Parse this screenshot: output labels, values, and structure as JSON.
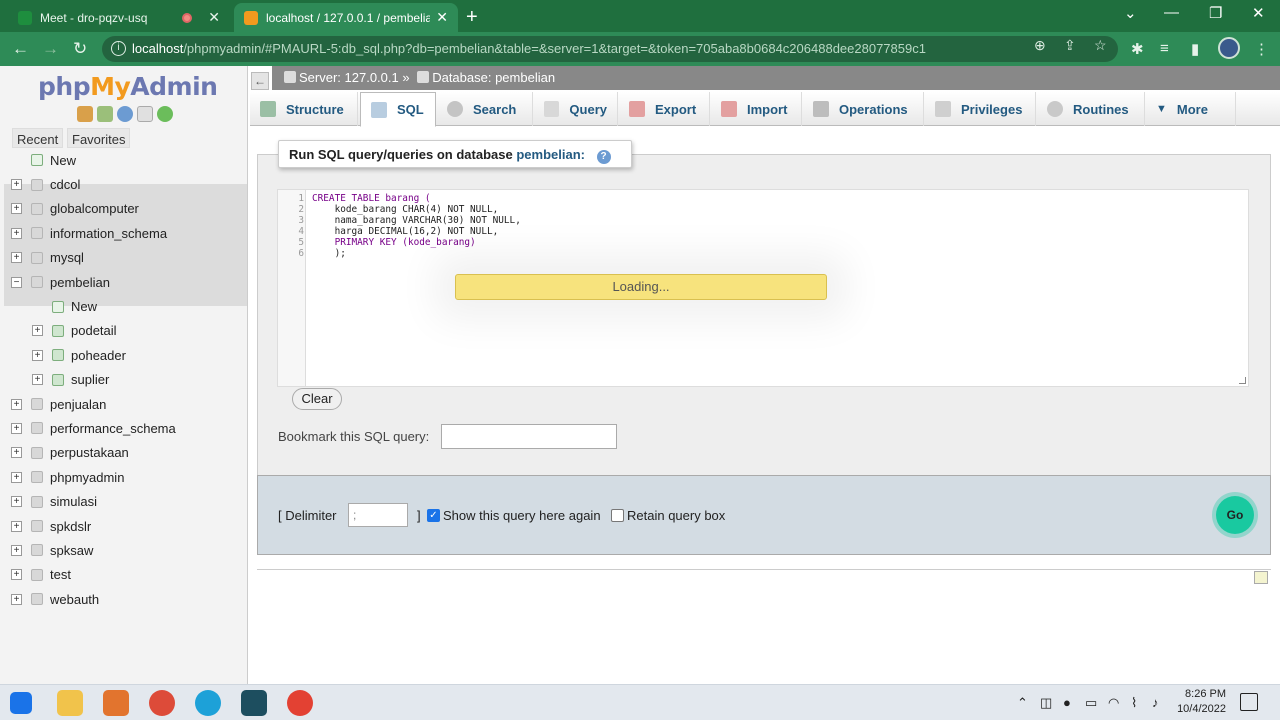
{
  "browser": {
    "tabs": [
      {
        "title": "Meet - dro-pqzv-usq",
        "favicon_color": "#1e8e3e"
      },
      {
        "title": "localhost / 127.0.0.1 / pembelian",
        "favicon_color": "#f29a1e"
      }
    ],
    "url_host": "localhost",
    "url_rest": "/phpmyadmin/#PMAURL-5:db_sql.php?db=pembelian&table=&server=1&target=&token=705aba8b0684c206488dee28077859c1"
  },
  "sidebar": {
    "logo_php": "php",
    "logo_my": "My",
    "logo_admin": "Admin",
    "recent": "Recent",
    "favorites": "Favorites",
    "new": "New",
    "databases": [
      "cdcol",
      "globalcomputer",
      "information_schema",
      "mysql",
      "pembelian"
    ],
    "pembelian_children": {
      "new": "New",
      "tables": [
        "podetail",
        "poheader",
        "suplier"
      ]
    },
    "databases_after": [
      "penjualan",
      "performance_schema",
      "perpustakaan",
      "phpmyadmin",
      "simulasi",
      "spkdslr",
      "spksaw",
      "test",
      "webauth"
    ]
  },
  "breadcrumb": {
    "server": "Server: 127.0.0.1 »",
    "database": "Database: pembelian"
  },
  "tabs": [
    "Structure",
    "SQL",
    "Search",
    "Query",
    "Export",
    "Import",
    "Operations",
    "Privileges",
    "Routines",
    "More"
  ],
  "query_box": {
    "legend": "Run SQL query/queries on database",
    "db_name": "pembelian:",
    "code_lines": [
      "CREATE TABLE barang (",
      "    kode_barang CHAR(4) NOT NULL,",
      "    nama_barang VARCHAR(30) NOT NULL,",
      "    harga DECIMAL(16,2) NOT NULL,",
      "    PRIMARY KEY (kode_barang)",
      "    );"
    ],
    "line_numbers": [
      "1",
      "2",
      "3",
      "4",
      "5",
      "6"
    ],
    "loading": "Loading...",
    "clear": "Clear",
    "bookmark_label": "Bookmark this SQL query:"
  },
  "footer": {
    "delimiter_open": "[ Delimiter",
    "delimiter_value": ";",
    "delimiter_close": "]",
    "show_query": "Show this query here again",
    "show_query_checked": true,
    "retain": "Retain query box",
    "retain_checked": false,
    "go": "Go"
  },
  "taskbar": {
    "time": "8:26 PM",
    "date": "10/4/2022"
  }
}
